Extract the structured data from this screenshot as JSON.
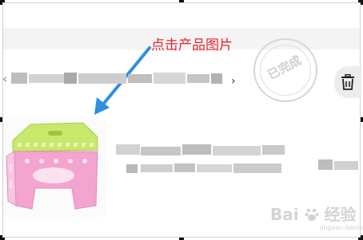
{
  "annotation": {
    "text": "点击产品图片"
  },
  "shop_row": {
    "chevron_left": "‹",
    "chevron_right": "›"
  },
  "stamp": {
    "label": "已完成"
  },
  "actions": {
    "delete_icon": "trash-icon"
  },
  "product": {
    "image_icon": "folding-stool-image"
  },
  "watermark": {
    "brand": "Bai",
    "brand_suffix": "经验",
    "sub": "jingyan.baidu.com"
  },
  "colors": {
    "annotation": "#e8242e",
    "arrow": "#2f8fe0",
    "stool_top": "#c7e86a",
    "stool_legs": "#f3a4cf"
  }
}
